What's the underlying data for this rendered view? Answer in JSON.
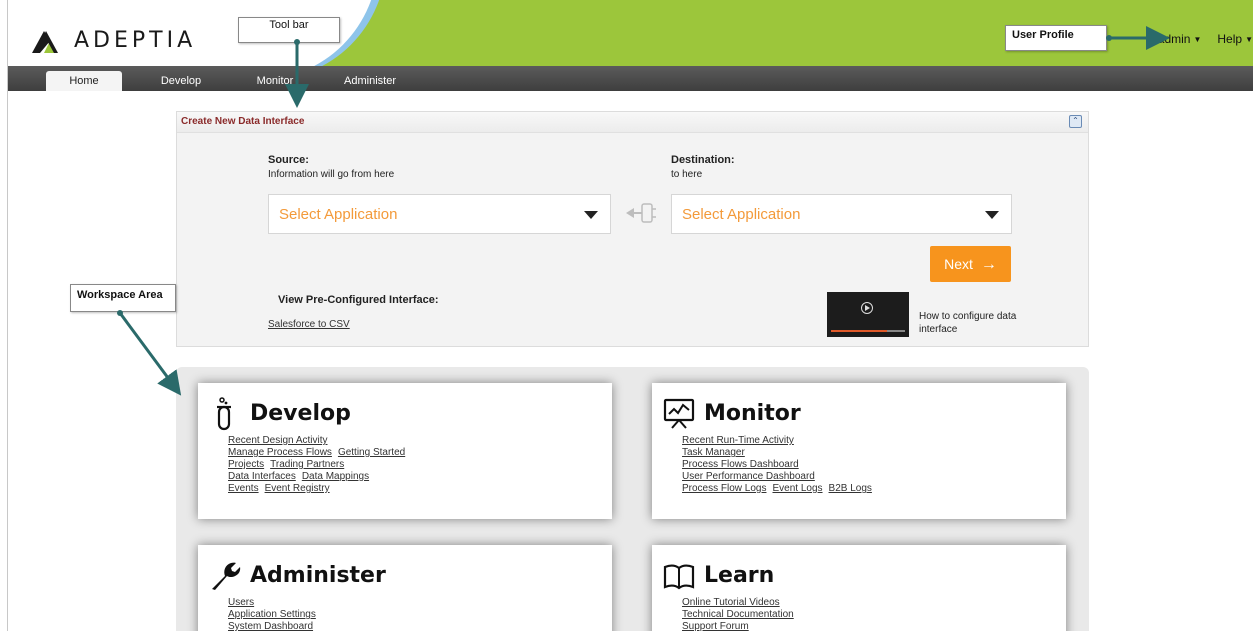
{
  "app": {
    "logo_text": "ADEPTIA"
  },
  "user_menu": {
    "admin_label": "admin",
    "help_label": "Help"
  },
  "tabs": [
    {
      "label": "Home",
      "active": true
    },
    {
      "label": "Develop"
    },
    {
      "label": "Monitor"
    },
    {
      "label": "Administer"
    }
  ],
  "callouts": {
    "toolbar": "Tool bar",
    "user_profile": "User Profile",
    "workspace": "Workspace Area"
  },
  "create_panel": {
    "title": "Create New Data Interface",
    "collapse_icon": "double-chevron-up-icon",
    "source_label": "Source:",
    "source_sub": "Information will go from here",
    "dest_label": "Destination:",
    "dest_sub": "to here",
    "source_select": "Select Application",
    "dest_select": "Select Application",
    "next_label": "Next",
    "preconf_label": "View Pre-Configured Interface:",
    "preconf_link": "Salesforce to CSV",
    "video_caption": "How to configure data interface"
  },
  "cards": {
    "develop": {
      "title": "Develop",
      "rows": [
        [
          "Recent Design Activity"
        ],
        [
          "Manage Process Flows",
          "Getting Started"
        ],
        [
          "Projects",
          "Trading Partners"
        ],
        [
          "Data Interfaces",
          "Data Mappings"
        ],
        [
          "Events",
          "Event Registry"
        ]
      ]
    },
    "monitor": {
      "title": "Monitor",
      "rows": [
        [
          "Recent Run-Time Activity"
        ],
        [
          "Task Manager"
        ],
        [
          "Process Flows Dashboard"
        ],
        [
          "User Performance Dashboard"
        ],
        [
          "Process Flow Logs",
          "Event Logs",
          "B2B Logs"
        ]
      ]
    },
    "administer": {
      "title": "Administer",
      "rows": [
        [
          "Users"
        ],
        [
          "Application Settings"
        ],
        [
          "System Dashboard"
        ]
      ]
    },
    "learn": {
      "title": "Learn",
      "rows": [
        [
          "Online Tutorial Videos"
        ],
        [
          "Technical Documentation"
        ],
        [
          "Support Forum"
        ]
      ]
    }
  },
  "colors": {
    "header_green": "#9cc63b",
    "accent_orange": "#f7941d",
    "select_text": "#f39a3a",
    "panel_title": "#8a2a2a"
  }
}
